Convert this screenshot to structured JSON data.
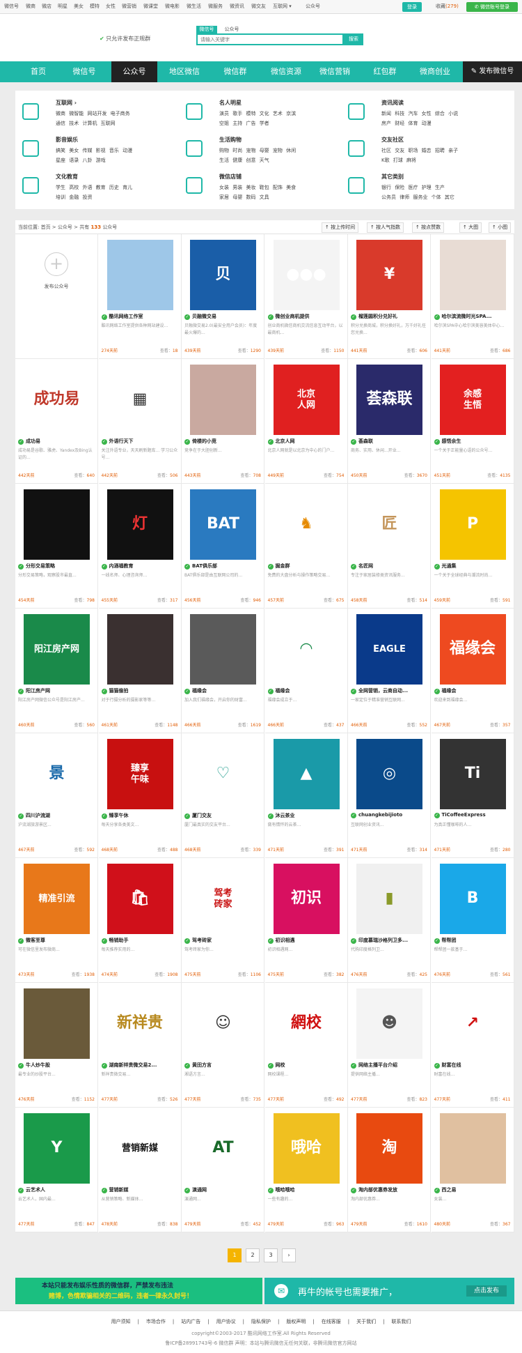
{
  "topbar": {
    "links": [
      "微信号",
      "微商",
      "微店",
      "明星",
      "美女",
      "模特",
      "女性",
      "微营销",
      "微课堂",
      "微电影",
      "微生活",
      "微服务",
      "微资讯",
      "微交友",
      "互联网 ▾",
      "公众号"
    ],
    "login": "登录",
    "fav": "收藏",
    "fav_count": "(279)",
    "wechat_login": "微信账号登录"
  },
  "header": {
    "slogan": "只允许发布正规群",
    "search_tabs": [
      "微信号",
      "公众号"
    ],
    "search_placeholder": "请输入关键字",
    "search_button": "搜索"
  },
  "nav": {
    "items": [
      "首页",
      "微信号",
      "公众号",
      "地区微信",
      "微信群",
      "微信资源",
      "微信营销",
      "红包群",
      "微商创业"
    ],
    "publish": "发布微信号"
  },
  "categories": [
    {
      "title": "互联网 ›",
      "lines": [
        "微商 微智能 网站开发 电子商务",
        "通信 技术 计算机 互联网"
      ]
    },
    {
      "title": "名人明星",
      "lines": [
        "演员 歌手 模特 文化 艺术 京滨",
        "空姐 主持 广告 学者"
      ]
    },
    {
      "title": "资讯阅读",
      "lines": [
        "新闻 科技 汽车 女性 综合 小说",
        "房产 财经 体育 动漫"
      ]
    },
    {
      "title": "影音娱乐",
      "lines": [
        "搞笑 美女 传媒 影视 音乐 动漫",
        "星座 语录 八卦 游戏"
      ]
    },
    {
      "title": "生活购物",
      "lines": [
        "购物 时尚 宠物 母婴 宠物 休闲",
        "生活 健康 创意 天气"
      ]
    },
    {
      "title": "交友社区",
      "lines": [
        "社区 交友 职场 婚恋 招聘 亲子",
        "K歌 打球 麻将"
      ]
    },
    {
      "title": "文化教育",
      "lines": [
        "学生 高校 外语 教育 历史 育儿",
        "培训 金融 投资"
      ]
    },
    {
      "title": "微信店铺",
      "lines": [
        "女装 男装 美妆 鞋包 配饰 美食",
        "家居 母婴 数码 文具"
      ]
    },
    {
      "title": "其它类别",
      "lines": [
        "银行 保险 医疗 护理 生产",
        "公务员 律师 服务业 个体 其它"
      ]
    }
  ],
  "breadcrumb": {
    "prefix": "当前位置: 首页 > 公众号 > 共有",
    "count": "133",
    "suffix": "公众号"
  },
  "sort_buttons": [
    "按上传时间",
    "按人气指数",
    "按点赞数",
    "大图",
    "小图"
  ],
  "add_card": {
    "label": "发布公众号"
  },
  "cards": [
    {
      "name": "酷讯网络工作室",
      "desc": "酷讯网络工作室提供各种网站建设...",
      "date": "274天前",
      "views": "18",
      "bg": "#9ec7e8",
      "txt": ""
    },
    {
      "name": "贝融微交易",
      "desc": "贝融微交易2.0(最安全用户会员)：年度最火爆的...",
      "date": "439天前",
      "views": "1290",
      "bg": "#1a5ea8",
      "txt": "贝"
    },
    {
      "name": "微创业商机提供",
      "desc": "创业商机微信商机交流信息互动平台，以最商机...",
      "date": "439天前",
      "views": "1150",
      "bg": "#f4f4f4",
      "txt": "●●●"
    },
    {
      "name": "榴莲圆积分兑好礼",
      "desc": "积分兑换商城，积分换好礼，万千好礼任您兑换...",
      "date": "441天前",
      "views": "606",
      "bg": "#d93a2b",
      "txt": "¥"
    },
    {
      "name": "哈尔滨流微时光SPA...",
      "desc": "哈尔滨SPA中心哈尔滨美容美体中心...",
      "date": "441天前",
      "views": "686",
      "bg": "#e8dcd4",
      "txt": ""
    },
    {
      "name": "成功易",
      "desc": "成功易是谷歌、雅虎、Yandex及Bing认证的...",
      "date": "442天前",
      "views": "640",
      "bg": "#ffffff",
      "txt": "成功易",
      "tc": "#c0392b"
    },
    {
      "name": "外语行天下",
      "desc": "关注外语专业，天天刷新题库... 学习公众号...",
      "date": "442天前",
      "views": "506",
      "bg": "#ffffff",
      "txt": "▦",
      "tc": "#333"
    },
    {
      "name": "倚楼的小竞",
      "desc": "竞争在于大胆创新...",
      "date": "443天前",
      "views": "708",
      "bg": "#c9a9a0",
      "txt": ""
    },
    {
      "name": "北京人网",
      "desc": "北京人网就是以北京为中心的门户...",
      "date": "449天前",
      "views": "754",
      "bg": "#e02020",
      "txt": "北京\n人网"
    },
    {
      "name": "荟森联",
      "desc": "商务、实用、休闲...开业...",
      "date": "450天前",
      "views": "3670",
      "bg": "#2a2a6a",
      "txt": "荟森联"
    },
    {
      "name": "感悟余生",
      "desc": "一个关于正能量心语的公众号...",
      "date": "451天前",
      "views": "4135",
      "bg": "#e32020",
      "txt": "余感\n生悟"
    },
    {
      "name": "分形交易策略",
      "desc": "分形交易策略，观察股市最直...",
      "date": "454天前",
      "views": "798",
      "bg": "#111",
      "txt": ""
    },
    {
      "name": "内酒福教育",
      "desc": "一线名师、心理咨询师...",
      "date": "455天前",
      "views": "317",
      "bg": "#111",
      "txt": "灯",
      "tc": "#e33"
    },
    {
      "name": "BAT俱乐部",
      "desc": "BAT俱乐部是由互联网公司的...",
      "date": "456天前",
      "views": "946",
      "bg": "#2a7ac0",
      "txt": "BAT"
    },
    {
      "name": "掘金群",
      "desc": "免费的大盘分析与操作策略交易...",
      "date": "457天前",
      "views": "675",
      "bg": "#ffffff",
      "txt": "♞",
      "tc": "#e68a00"
    },
    {
      "name": "名匠网",
      "desc": "专注于家居装修类资讯服务...",
      "date": "458天前",
      "views": "514",
      "bg": "#ffffff",
      "txt": "匠",
      "tc": "#c4955a"
    },
    {
      "name": "光通集",
      "desc": "一个关于全球经典与潮流时尚...",
      "date": "459天前",
      "views": "591",
      "bg": "#f5c400",
      "txt": "P"
    },
    {
      "name": "阳江房产网",
      "desc": "阳江房产网微信公众号是阳江房产...",
      "date": "460天前",
      "views": "560",
      "bg": "#1a8a4a",
      "txt": "阳江房产网"
    },
    {
      "name": "猫猫偷拍",
      "desc": "对于行摄分析的摄影家等等...",
      "date": "461天前",
      "views": "1148",
      "bg": "#3a3030",
      "txt": ""
    },
    {
      "name": "福缘会",
      "desc": "加入我们福缘会，开启你的财富...",
      "date": "466天前",
      "views": "1619",
      "bg": "#5a5a5a",
      "txt": ""
    },
    {
      "name": "福缘会",
      "desc": "福缘会成立于...",
      "date": "466天前",
      "views": "437",
      "bg": "#ffffff",
      "txt": "◠",
      "tc": "#1a8a4a"
    },
    {
      "name": "全网营销，云商自动...",
      "desc": "一家定位于精准营销互联网...",
      "date": "466天前",
      "views": "552",
      "bg": "#0a3a8a",
      "txt": "EAGLE"
    },
    {
      "name": "福缘会",
      "desc": "欢迎来到福缘会...",
      "date": "467天前",
      "views": "357",
      "bg": "#ee4a20",
      "txt": "福缘会"
    },
    {
      "name": "四川沪流湖",
      "desc": "沪流湖旅游景区...",
      "date": "467天前",
      "views": "592",
      "bg": "#ffffff",
      "txt": "景",
      "tc": "#1a6aaa"
    },
    {
      "name": "臻享午休",
      "desc": "每天分享各类美文...",
      "date": "468天前",
      "views": "488",
      "bg": "#c81010",
      "txt": "臻享\n午味"
    },
    {
      "name": "厦门交友",
      "desc": "厦门最真实的交友平台...",
      "date": "468天前",
      "views": "339",
      "bg": "#ffffff",
      "txt": "♡",
      "tc": "#1a9a8a"
    },
    {
      "name": "沐云茶业",
      "desc": "做有情怀的云茶...",
      "date": "471天前",
      "views": "391",
      "bg": "#1a9aa8",
      "txt": "▲"
    },
    {
      "name": "chuangkebijioto",
      "desc": "互联网创业资讯...",
      "date": "471天前",
      "views": "314",
      "bg": "#0a4a8a",
      "txt": "◎"
    },
    {
      "name": "TiCoffeeExpress",
      "desc": "为真正懂咖啡的人...",
      "date": "471天前",
      "views": "280",
      "bg": "#333",
      "txt": "Ti"
    },
    {
      "name": "微客至尊",
      "desc": "可在微信里发布微商...",
      "date": "473天前",
      "views": "1938",
      "bg": "#e8781a",
      "txt": "精准引流"
    },
    {
      "name": "畅销助手",
      "desc": "每天推荐实用的...",
      "date": "474天前",
      "views": "1908",
      "bg": "#d0101a",
      "txt": "🛍"
    },
    {
      "name": "驾考砖家",
      "desc": "驾考砖家为你...",
      "date": "475天前",
      "views": "1106",
      "bg": "#ffffff",
      "txt": "驾考\n砖家",
      "tc": "#c81010"
    },
    {
      "name": "初识相遇",
      "desc": "初识相遇网...",
      "date": "475天前",
      "views": "382",
      "bg": "#d81060",
      "txt": "初识"
    },
    {
      "name": "印度慕瑞沙格列卫多...",
      "desc": "代购印度格列卫...",
      "date": "476天前",
      "views": "425",
      "bg": "#f0f0f0",
      "txt": "▮",
      "tc": "#8a9a2a"
    },
    {
      "name": "帮帮团",
      "desc": "帮帮团一款基于...",
      "date": "476天前",
      "views": "561",
      "bg": "#1aa8e8",
      "txt": "B"
    },
    {
      "name": "牛人炒牛股",
      "desc": "最专业的炒股平台...",
      "date": "476天前",
      "views": "1152",
      "bg": "#6a5a3a",
      "txt": ""
    },
    {
      "name": "湖南新祥贵微交易2...",
      "desc": "新祥贵微交易...",
      "date": "477天前",
      "views": "526",
      "bg": "#ffffff",
      "txt": "新祥贵",
      "tc": "#b88a20"
    },
    {
      "name": "黄田方言",
      "desc": "湘语方言...",
      "date": "477天前",
      "views": "735",
      "bg": "#ffffff",
      "txt": "☺",
      "tc": "#333"
    },
    {
      "name": "网校",
      "desc": "网校课程...",
      "date": "477天前",
      "views": "492",
      "bg": "#ffffff",
      "txt": "網校",
      "tc": "#d01010"
    },
    {
      "name": "网络主播平台介绍",
      "desc": "提供网络主播...",
      "date": "477天前",
      "views": "823",
      "bg": "#f4f4f4",
      "txt": "☻",
      "tc": "#555"
    },
    {
      "name": "财富在线",
      "desc": "财富在线...",
      "date": "477天前",
      "views": "411",
      "bg": "#ffffff",
      "txt": "↗",
      "tc": "#d01010"
    },
    {
      "name": "云艺术人",
      "desc": "云艺术人，国内最...",
      "date": "477天前",
      "views": "847",
      "bg": "#1a9a4a",
      "txt": "Y"
    },
    {
      "name": "营销新媒",
      "desc": "从营销策略、新媒体...",
      "date": "478天前",
      "views": "838",
      "bg": "#ffffff",
      "txt": "营销新媒",
      "tc": "#111"
    },
    {
      "name": "演通网",
      "desc": "演通网...",
      "date": "479天前",
      "views": "452",
      "bg": "#ffffff",
      "txt": "AT",
      "tc": "#1a6a2a"
    },
    {
      "name": "哦哈哦哈",
      "desc": "一些有趣的...",
      "date": "479天前",
      "views": "963",
      "bg": "#f0c020",
      "txt": "哦哈"
    },
    {
      "name": "淘内部优惠券发放",
      "desc": "淘内部优惠券...",
      "date": "479天前",
      "views": "1610",
      "bg": "#e84a10",
      "txt": "淘"
    },
    {
      "name": "西之易",
      "desc": "女装...",
      "date": "480天前",
      "views": "367",
      "bg": "#e0c0a0",
      "txt": ""
    }
  ],
  "pagination": [
    "1",
    "2",
    "3",
    "›"
  ],
  "banner1": {
    "l1": "本站只能发布娱乐性质的微信群，严禁发布违法",
    "l2": "赌博，色情欺骗相关的二维码，违者一律永久封号！"
  },
  "banner2": {
    "text": "再牛的帐号也需要推广，",
    "btn": "点击发布"
  },
  "footer": {
    "links": [
      "用户须知",
      "市场合作",
      "站内广告",
      "用户协议",
      "隐私保护",
      "版权声明",
      "在线客服",
      "关于我们",
      "联系我们"
    ],
    "copyright": "copyright©2003-2017 酷讯网络工作室.All Rights Reserved",
    "icp": "鲁ICP备28991743号-6 微信群  声明：本站与腾讯微信无任何关联，非腾讯微信官方网站"
  }
}
